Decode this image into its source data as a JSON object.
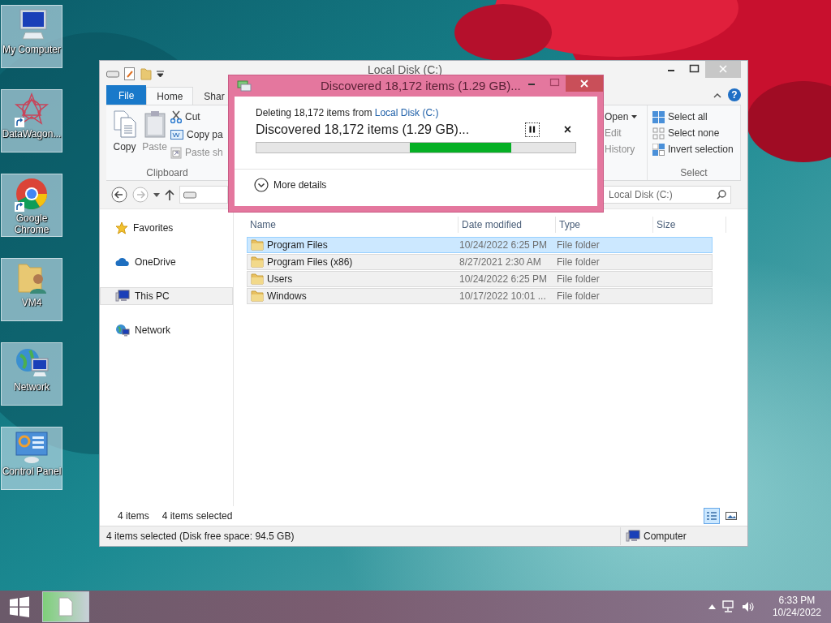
{
  "desktop_icons": [
    {
      "label": "My Computer",
      "kind": "computer",
      "shortcut": false
    },
    {
      "label": "DataWagon...",
      "kind": "star",
      "shortcut": true
    },
    {
      "label": "Google Chrome",
      "kind": "chrome",
      "shortcut": true
    },
    {
      "label": "VM4",
      "kind": "user_folder",
      "shortcut": false
    },
    {
      "label": "Network",
      "kind": "network",
      "shortcut": false
    },
    {
      "label": "Control Panel",
      "kind": "control_panel",
      "shortcut": false
    }
  ],
  "explorer": {
    "title": "Local Disk (C:)",
    "ribbon_tabs": [
      {
        "label": "File",
        "kind": "file"
      },
      {
        "label": "Home",
        "kind": "tab",
        "selected": true
      },
      {
        "label": "Shar",
        "kind": "tab",
        "selected": false
      }
    ],
    "help": "?",
    "clipboard": {
      "label": "Clipboard",
      "large_buttons": [
        {
          "label": "Copy",
          "kind": "copy",
          "disabled": false
        },
        {
          "label": "Paste",
          "kind": "paste",
          "disabled": true
        }
      ],
      "small_buttons": [
        {
          "label": "Cut",
          "kind": "cut",
          "disabled": false
        },
        {
          "label": "Copy pa",
          "kind": "copy_path",
          "disabled": false
        },
        {
          "label": "Paste sh",
          "kind": "paste_shortcut",
          "disabled": true
        }
      ]
    },
    "open_group": {
      "items": [
        {
          "label": "Open",
          "dropdown": true,
          "disabled": false
        },
        {
          "label": "Edit",
          "dropdown": false,
          "disabled": true
        },
        {
          "label": "History",
          "dropdown": false,
          "disabled": true
        }
      ]
    },
    "select_group": {
      "label": "Select",
      "items": [
        {
          "label": "Select all",
          "kind": "all"
        },
        {
          "label": "Select none",
          "kind": "none"
        },
        {
          "label": "Invert selection",
          "kind": "invert"
        }
      ]
    },
    "search": {
      "placeholder": "Local Disk (C:)"
    },
    "nav_items": [
      {
        "label": "Favorites",
        "kind": "favorites",
        "selected": false
      },
      {
        "label": "OneDrive",
        "kind": "cloud",
        "selected": false
      },
      {
        "label": "This PC",
        "kind": "pc",
        "selected": true
      },
      {
        "label": "Network",
        "kind": "network",
        "selected": false
      }
    ],
    "table": {
      "columns": [
        "Name",
        "Date modified",
        "Type",
        "Size"
      ],
      "rows": [
        {
          "name": "Program Files",
          "date_modified": "10/24/2022 6:25 PM",
          "type": "File folder",
          "selected": true,
          "focused": true
        },
        {
          "name": "Program Files (x86)",
          "date_modified": "8/27/2021 2:30 AM",
          "type": "File folder",
          "selected": true,
          "focused": false
        },
        {
          "name": "Users",
          "date_modified": "10/24/2022 6:25 PM",
          "type": "File folder",
          "selected": true,
          "focused": false
        },
        {
          "name": "Windows",
          "date_modified": "10/17/2022 10:01 ...",
          "type": "File folder",
          "selected": true,
          "focused": false
        }
      ]
    },
    "item_count": "4 items",
    "selection_count": "4 items selected",
    "views": [
      {
        "kind": "details",
        "selected": true
      },
      {
        "kind": "tiles",
        "selected": false
      }
    ],
    "status_bar": {
      "text": "4 items selected (Disk free space: 94.5 GB)",
      "location": "Computer"
    }
  },
  "dialog": {
    "title": "Discovered 18,172 items (1.29 GB)...",
    "source_prefix": "Deleting 18,172 items from ",
    "source_link": "Local Disk (C:)",
    "headline": "Discovered 18,172 items (1.29 GB)...",
    "cancel": "×",
    "more_details": "More details"
  },
  "taskbar": {
    "time": "6:33 PM",
    "date": "10/24/2022"
  }
}
